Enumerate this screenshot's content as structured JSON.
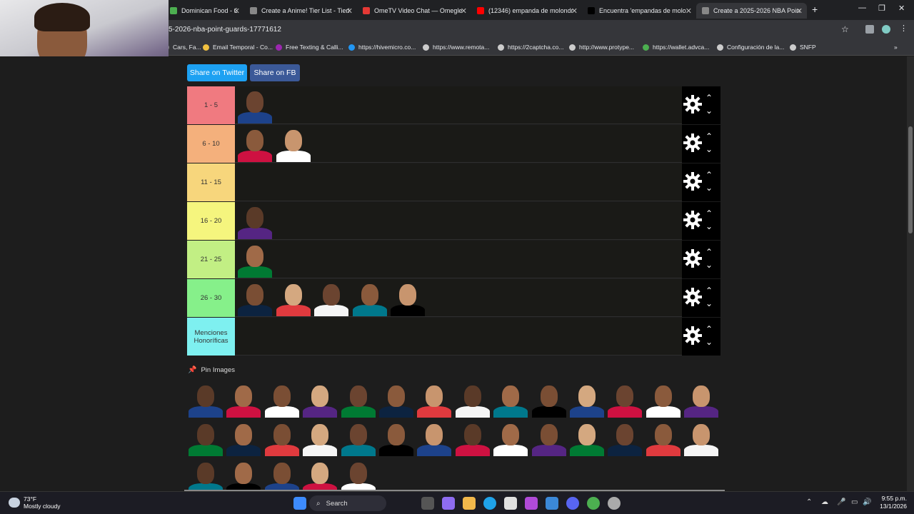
{
  "browser": {
    "tabs": [
      {
        "title": "Dominican Food - Co",
        "color": "#4caf50"
      },
      {
        "title": "Create a Anime! Tier List - Tierl",
        "color": "#888888"
      },
      {
        "title": "OmeTV Video Chat — Omegle",
        "color": "#e53935"
      },
      {
        "title": "(12346) empanda de molondr",
        "color": "#ff0000"
      },
      {
        "title": "Encuentra 'empandas de molo",
        "color": "#000000"
      },
      {
        "title": "Create a 2025-2026 NBA Point",
        "color": "#888888",
        "active": true
      }
    ],
    "new_tab": "+",
    "url": "5-2026-nba-point-guards-17771612",
    "bookmarks": [
      {
        "label": "Cars, Fa...",
        "color": "#888888"
      },
      {
        "label": "Email Temporal - Co...",
        "color": "#f0c040"
      },
      {
        "label": "Free Texting & Calli...",
        "color": "#9c27b0"
      },
      {
        "label": "https://hivemicro.co...",
        "color": "#2196f3"
      },
      {
        "label": "https://www.remota...",
        "color": "#cccccc"
      },
      {
        "label": "https://2captcha.co...",
        "color": "#cccccc"
      },
      {
        "label": "http://www.protype...",
        "color": "#cccccc"
      },
      {
        "label": "https://wallet.advca...",
        "color": "#4caf50"
      },
      {
        "label": "Configuración de la...",
        "color": "#cccccc"
      },
      {
        "label": "SNFP",
        "color": "#cccccc"
      }
    ],
    "more_bookmarks": "»"
  },
  "share": {
    "twitter": "Share on Twitter",
    "fb": "Share on FB"
  },
  "tiers": [
    {
      "label": "1 - 5",
      "color": "#f07a80",
      "players": 1
    },
    {
      "label": "6 - 10",
      "color": "#f4b07c",
      "players": 2
    },
    {
      "label": "11 - 15",
      "color": "#f7d67c",
      "players": 0
    },
    {
      "label": "16 - 20",
      "color": "#f5f57e",
      "players": 1
    },
    {
      "label": "21 - 25",
      "color": "#c2ef84",
      "players": 1
    },
    {
      "label": "26 - 30",
      "color": "#86f08a",
      "players": 5
    },
    {
      "label": "Menciones Honoríficas",
      "color": "#7ef0f0",
      "players": 0
    }
  ],
  "tier_controls": {
    "up": "⌃",
    "down": "⌄"
  },
  "pin_images": {
    "title": "Pin Images",
    "rows": [
      14,
      14,
      5
    ]
  },
  "taskbar": {
    "weather_temp": "73°F",
    "weather_desc": "Mostly cloudy",
    "search": "Search",
    "time": "9:55 p.m.",
    "date": "13/1/2026"
  }
}
